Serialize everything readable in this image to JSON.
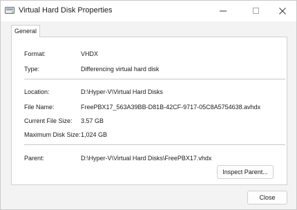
{
  "window": {
    "title": "Virtual Hard Disk Properties"
  },
  "tabs": [
    {
      "label": "General"
    }
  ],
  "properties": {
    "format_label": "Format:",
    "format_value": "VHDX",
    "type_label": "Type:",
    "type_value": "Differencing virtual hard disk",
    "location_label": "Location:",
    "location_value": "D:\\Hyper-V\\Virtual Hard Disks",
    "filename_label": "File Name:",
    "filename_value": "FreePBX17_563A39BB-D81B-42CF-9717-05C8A5754638.avhdx",
    "current_size_label": "Current File Size:",
    "current_size_value": "3.57 GB",
    "max_size_label": "Maximum Disk Size:",
    "max_size_value": "1,024 GB",
    "parent_label": "Parent:",
    "parent_value": "D:\\Hyper-V\\Virtual Hard Disks\\FreePBX17.vhdx"
  },
  "buttons": {
    "inspect_parent": "Inspect Parent...",
    "close": "Close"
  },
  "icons": {
    "app": "virtual-disk-icon",
    "minimize": "minimize-icon",
    "maximize": "maximize-icon",
    "close": "close-icon"
  }
}
